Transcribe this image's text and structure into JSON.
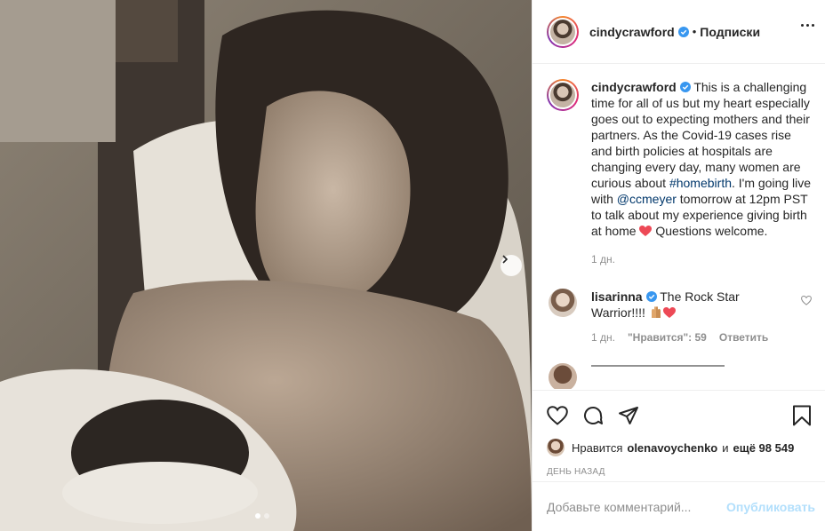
{
  "header": {
    "username": "cindycrawford",
    "separator": "•",
    "follow_label": "Подписки"
  },
  "caption": {
    "username": "cindycrawford",
    "part1": "This is a challenging time for all of us but my heart especially goes out to expecting mothers and their partners. As the Covid-19 cases rise and birth policies at hospitals are changing every day, many women are curious about ",
    "hashtag": "#homebirth",
    "part2": ". I'm going live with ",
    "mention": "@ccmeyer",
    "part3": " tomorrow at 12pm PST to talk about my experience giving birth at home ",
    "part4": " Questions welcome.",
    "time": "1 дн."
  },
  "comment": {
    "username": "lisarinna",
    "text": "The Rock Star Warrior!!!!",
    "time": "1 дн.",
    "likes": "\"Нравится\": 59",
    "reply": "Ответить"
  },
  "likes": {
    "word": "Нравится",
    "user": "olenavoychenko",
    "and": "и",
    "rest": "ещё 98 549"
  },
  "date": "ДЕНЬ НАЗАД",
  "add_comment": {
    "placeholder": "Добавьте комментарий...",
    "publish": "Опубликовать"
  },
  "carousel": {
    "count": 2,
    "active": 1
  },
  "colors": {
    "verified": "#3897f0",
    "heart": "#ed4956",
    "publish": "#b2dffc"
  },
  "icons": [
    "heart-icon",
    "comment-icon",
    "share-icon",
    "bookmark-icon",
    "chevron-right-icon",
    "more-icon",
    "verified-icon"
  ]
}
